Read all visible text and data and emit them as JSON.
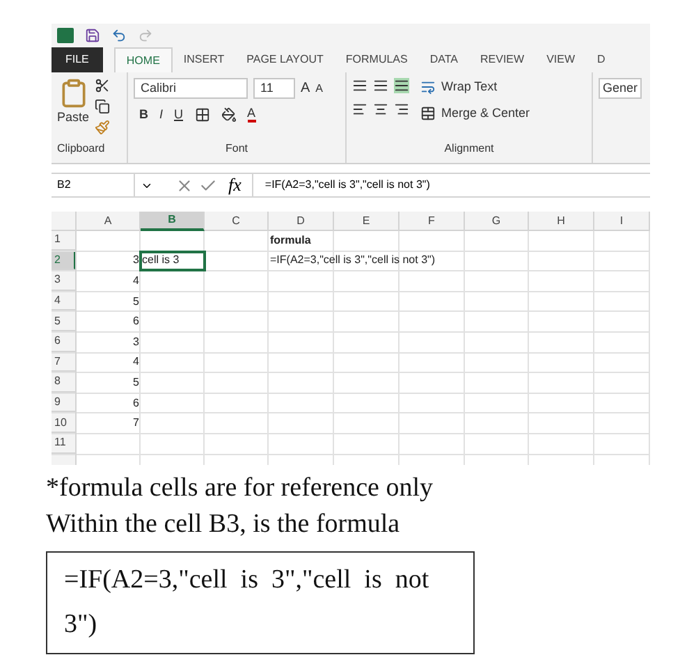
{
  "tabs": [
    {
      "label": "FILE",
      "kind": "file",
      "selected": false
    },
    {
      "label": "HOME",
      "kind": "tab",
      "selected": true
    },
    {
      "label": "INSERT",
      "kind": "tab",
      "selected": false
    },
    {
      "label": "PAGE LAYOUT",
      "kind": "tab",
      "selected": false
    },
    {
      "label": "FORMULAS",
      "kind": "tab",
      "selected": false
    },
    {
      "label": "DATA",
      "kind": "tab",
      "selected": false
    },
    {
      "label": "REVIEW",
      "kind": "tab",
      "selected": false
    },
    {
      "label": "VIEW",
      "kind": "tab",
      "selected": false
    },
    {
      "label": "D",
      "kind": "tab",
      "selected": false
    }
  ],
  "ribbon": {
    "clipboard": {
      "paste": "Paste",
      "label": "Clipboard"
    },
    "font": {
      "name": "Calibri",
      "size": "11",
      "grow": "A",
      "shrink": "A",
      "bold": "B",
      "italic": "I",
      "underline": "U",
      "color_letter": "A",
      "label": "Font"
    },
    "alignment": {
      "wrap": "Wrap Text",
      "merge": "Merge & Center",
      "label": "Alignment"
    },
    "number": {
      "format": "Gener"
    }
  },
  "formula_bar": {
    "name_box": "B2",
    "fx": "fx",
    "value": "=IF(A2=3,\"cell is 3\",\"cell is not 3\")"
  },
  "sheet": {
    "columns": [
      {
        "label": "A",
        "selected": false
      },
      {
        "label": "B",
        "selected": true
      },
      {
        "label": "C",
        "selected": false
      },
      {
        "label": "D",
        "selected": false
      },
      {
        "label": "E",
        "selected": false
      },
      {
        "label": "F",
        "selected": false
      },
      {
        "label": "G",
        "selected": false
      },
      {
        "label": "H",
        "selected": false
      },
      {
        "label": "I",
        "selected": false
      }
    ],
    "rows": [
      {
        "number": "1",
        "selected": false,
        "cells": {
          "d": {
            "text": "formula",
            "bold": true,
            "selected": false
          }
        }
      },
      {
        "number": "2",
        "selected": true,
        "cells": {
          "a": {
            "text": "3",
            "selected": false
          },
          "b": {
            "text": "cell is 3",
            "selected": true
          },
          "d": {
            "text": "=IF(A2=3,\"cell is 3\",\"cell is not 3\")",
            "selected": false
          }
        }
      },
      {
        "number": "3",
        "selected": false,
        "cells": {
          "a": {
            "text": "4",
            "selected": false
          }
        }
      },
      {
        "number": "4",
        "selected": false,
        "cells": {
          "a": {
            "text": "5",
            "selected": false
          }
        }
      },
      {
        "number": "5",
        "selected": false,
        "cells": {
          "a": {
            "text": "6",
            "selected": false
          }
        }
      },
      {
        "number": "6",
        "selected": false,
        "cells": {
          "a": {
            "text": "3",
            "selected": false
          }
        }
      },
      {
        "number": "7",
        "selected": false,
        "cells": {
          "a": {
            "text": "4",
            "selected": false
          }
        }
      },
      {
        "number": "8",
        "selected": false,
        "cells": {
          "a": {
            "text": "5",
            "selected": false
          }
        }
      },
      {
        "number": "9",
        "selected": false,
        "cells": {
          "a": {
            "text": "6",
            "selected": false
          }
        }
      },
      {
        "number": "10",
        "selected": false,
        "cells": {
          "a": {
            "text": "7",
            "selected": false
          }
        }
      },
      {
        "number": "11",
        "selected": false,
        "cells": {}
      }
    ]
  },
  "note": "*formula cells are for reference only",
  "intro": "Within the cell B3, is the formula",
  "formula_box": "=IF(A2=3,\"cell  is  3\",\"cell  is  not 3\")"
}
